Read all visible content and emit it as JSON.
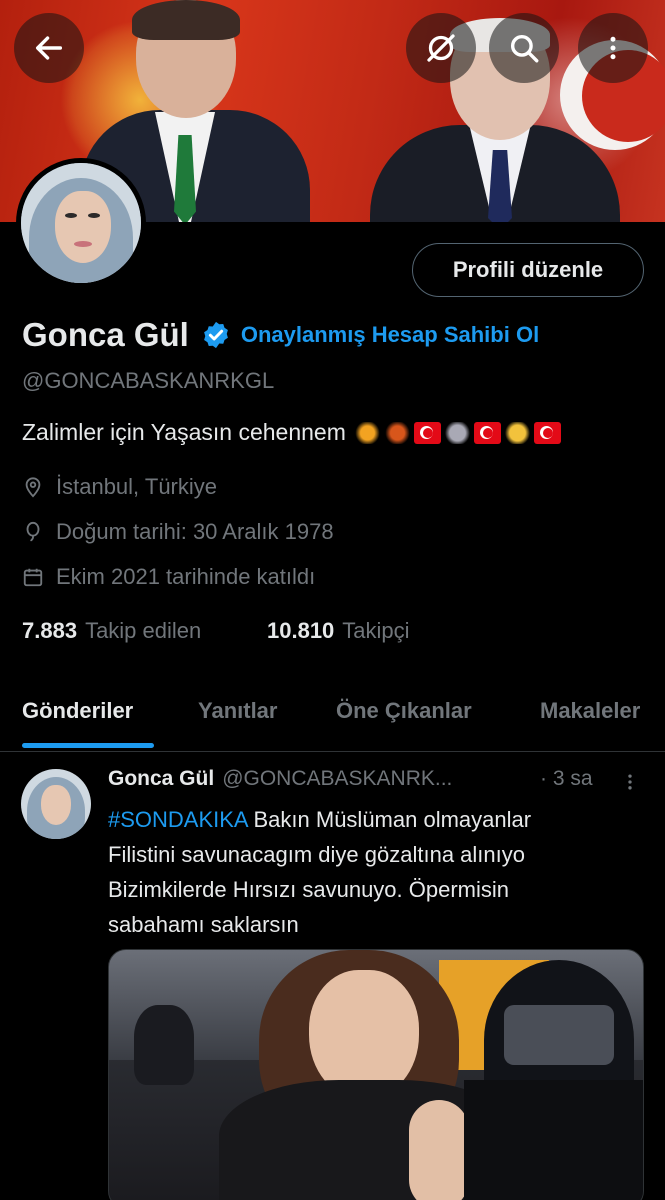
{
  "header": {
    "back_icon": "arrow-left-icon",
    "grok_icon": "grok-icon",
    "search_icon": "search-icon",
    "more_icon": "more-vertical-icon"
  },
  "profile": {
    "edit_button_label": "Profili düzenle",
    "name": "Gonca Gül",
    "verify_link": "Onaylanmış Hesap Sahibi Ol",
    "handle": "@GONCABASKANRKGL",
    "bio": "Zalimler  için  Yaşasın cehennem",
    "location": "İstanbul, Türkiye",
    "birthday": "Doğum tarihi: 30 Aralık 1978",
    "joined": "Ekim 2021 tarihinde katıldı",
    "following_count": "7.883",
    "following_label": "Takip edilen",
    "followers_count": "10.810",
    "followers_label": "Takipçi"
  },
  "tabs": [
    {
      "label": "Gönderiler",
      "active": true
    },
    {
      "label": "Yanıtlar",
      "active": false
    },
    {
      "label": "Öne Çıkanlar",
      "active": false
    },
    {
      "label": "Makaleler",
      "active": false
    }
  ],
  "post": {
    "author": "Gonca Gül",
    "handle": "@GONCABASKANRK...",
    "time": "· 3 sa",
    "hashtag": "#SONDAKIKA",
    "line1_rest": " Bakın  Müslüman olmayanlar",
    "line2": "Filistini  savunacagım  diye gözaltına alınıyo",
    "line3": "Bizimkilerde  Hırsızı  savunuyo. Öpermisin",
    "line4": "sabahamı  saklarsın"
  },
  "colors": {
    "accent": "#1d9bf0",
    "background": "#000000",
    "secondary_text": "#71767b"
  }
}
